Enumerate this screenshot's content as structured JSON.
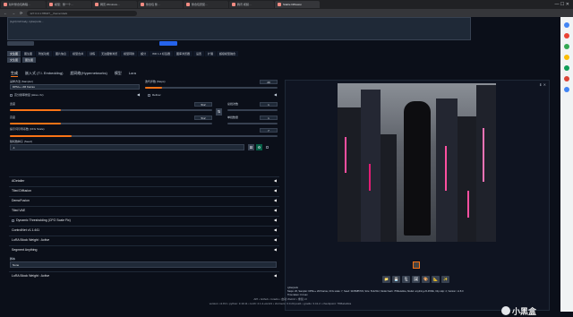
{
  "browser": {
    "tabs": [
      "秋叶整合包教程…",
      "模型：整一个…",
      "网页 Windows…",
      "整合包 整…",
      "整合包安装…",
      "腾讯 视频…",
      "Stable Diffusion"
    ],
    "active_tab_index": 6,
    "url": "127.0.0.1:7860/?__theme=dark"
  },
  "prompt_text": "(1girl) full body, cyberpunk...",
  "prompt_box_note": "",
  "vae_value": "",
  "top_tabs": [
    "文生图",
    "图生图",
    "附加功能",
    "图片信息",
    "模型合并",
    "训练",
    "无边图像浏览",
    "模型转换",
    "超分",
    "WD 1.4 标签器",
    "图库浏览器",
    "设置",
    "扩展",
    "超级模型融合"
  ],
  "sub_tabs": [
    "生成",
    "嵌入式 (T.I. Embedding)",
    "超网络 (Hypernetworks)",
    "模型",
    "Lora"
  ],
  "gen_tabs": [
    "生成",
    "嵌入式 (T.I. Embedding)",
    "超网络(Hypernetworks)",
    "模型",
    "Lora"
  ],
  "active_gen_tab": 0,
  "params": {
    "sampler_label": "采样方法 (Sampler)",
    "sampler_value": "DPM++ 2M Karras",
    "steps_label": "迭代步数 (Steps)",
    "steps_value": "20",
    "steps_fraction": 0.13,
    "hires_label": "高分辨率修复 (Hires. fix)",
    "refiner_label": "Refiner",
    "width_label": "宽度",
    "width_value": "512",
    "width_fraction": 0.25,
    "height_label": "高度",
    "height_value": "512",
    "height_fraction": 0.25,
    "batch_count_label": "总批次数",
    "batch_count_value": "1",
    "batch_size_label": "单批数量",
    "batch_size_value": "1",
    "cfg_label": "提示词引导系数 (CFG Scale)",
    "cfg_value": "7",
    "cfg_fraction": 0.23,
    "seed_label": "随机数种子 (Seed)",
    "seed_value": "-1"
  },
  "accordions": [
    "ADetailer",
    "Tiled Diffusion",
    "DemoFusion",
    "Tiled VAE",
    "Dynamic Thresholding (CFG Scale Fix)",
    "ControlNet v1.1.441",
    "LoRA Block Weight : Active",
    "Segment Anything"
  ],
  "script_label": "脚本",
  "script_value": "None",
  "last_accordion": "LoRA Block Weight : Active",
  "output": {
    "caption": "cyberpunk",
    "info": "Steps: 20, Sampler: DPM++ 2M Karras, CFG scale: 7, Seed: 3165985733, Size: 512x512, Model hash: 7f96a1a9ca, Model: anything-v5-PrtRE, Clip skip: 2, Version: v1.8.0",
    "time": "Time taken: 3.4 sec.",
    "action_icons": [
      "folder-icon",
      "save-icon",
      "zip-icon",
      "image-icon",
      "palette-icon",
      "resize-icon",
      "star-icon"
    ]
  },
  "footer": {
    "line1": "API • Github • Gradio • 启动 WebUI • 重载 UI",
    "line2": "version: v1.8.0 • python: 3.10.11 • torch: 2.1.2+cu121 • xformers: 0.0.23.post1 • gradio: 3.41.2 • checkpoint: 7f96a1a9ca"
  },
  "watermark": "小黑盒"
}
